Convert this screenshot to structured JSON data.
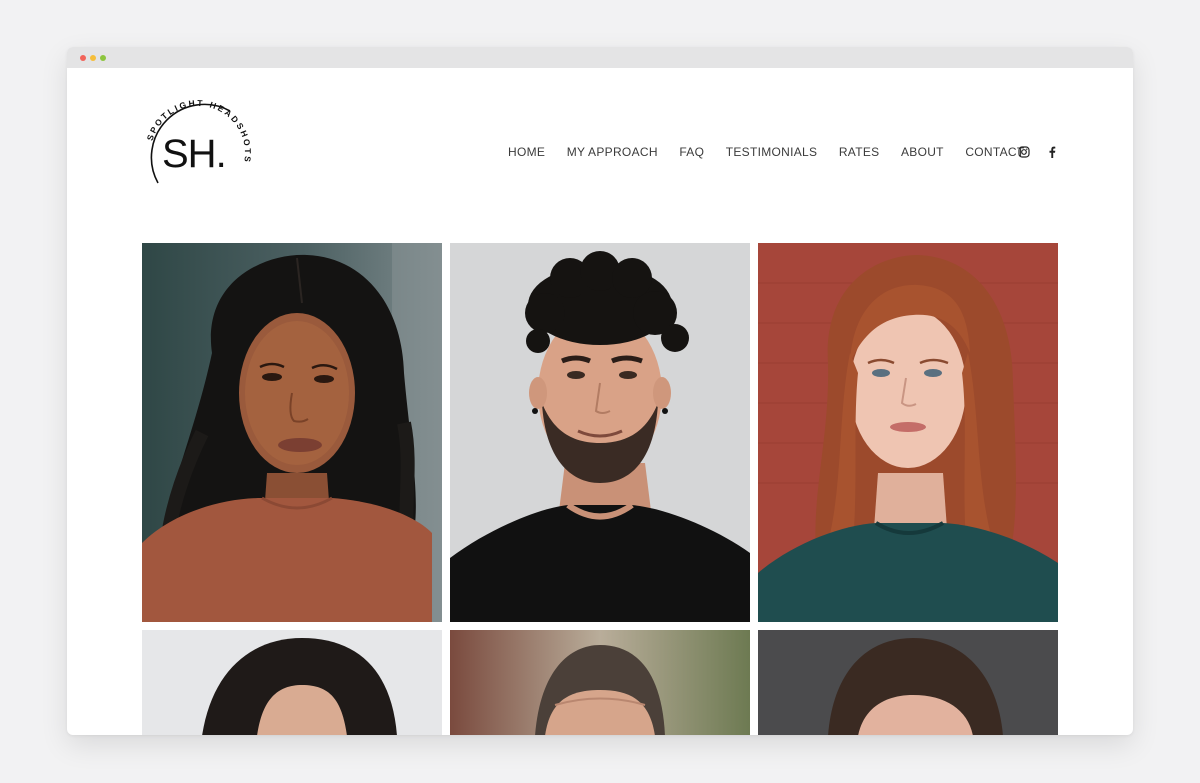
{
  "logo": {
    "monogram": "SH.",
    "ring_text": "SPOTLIGHT HEADSHOTS"
  },
  "nav": {
    "items": [
      "HOME",
      "MY APPROACH",
      "FAQ",
      "TESTIMONIALS",
      "RATES",
      "ABOUT",
      "CONTACT"
    ]
  },
  "social": {
    "icons": [
      "instagram-icon",
      "facebook-icon"
    ]
  },
  "gallery": {
    "photos": [
      {
        "subject": "woman with braids, rust top",
        "bg": "#3f5657"
      },
      {
        "subject": "man with curly hair, black t-shirt",
        "bg": "#d6d7d8"
      },
      {
        "subject": "red-haired woman, teal top",
        "bg": "#a7473a"
      },
      {
        "subject": "woman with dark hair",
        "bg": "#e7e8ea"
      },
      {
        "subject": "man outdoors",
        "bg": "#9b8a78"
      },
      {
        "subject": "woman, dark backdrop",
        "bg": "#4a4a4c"
      }
    ]
  },
  "colors": {
    "page_bg": "#f2f2f3",
    "nav_text": "#3b3b3b",
    "logo": "#111111"
  }
}
